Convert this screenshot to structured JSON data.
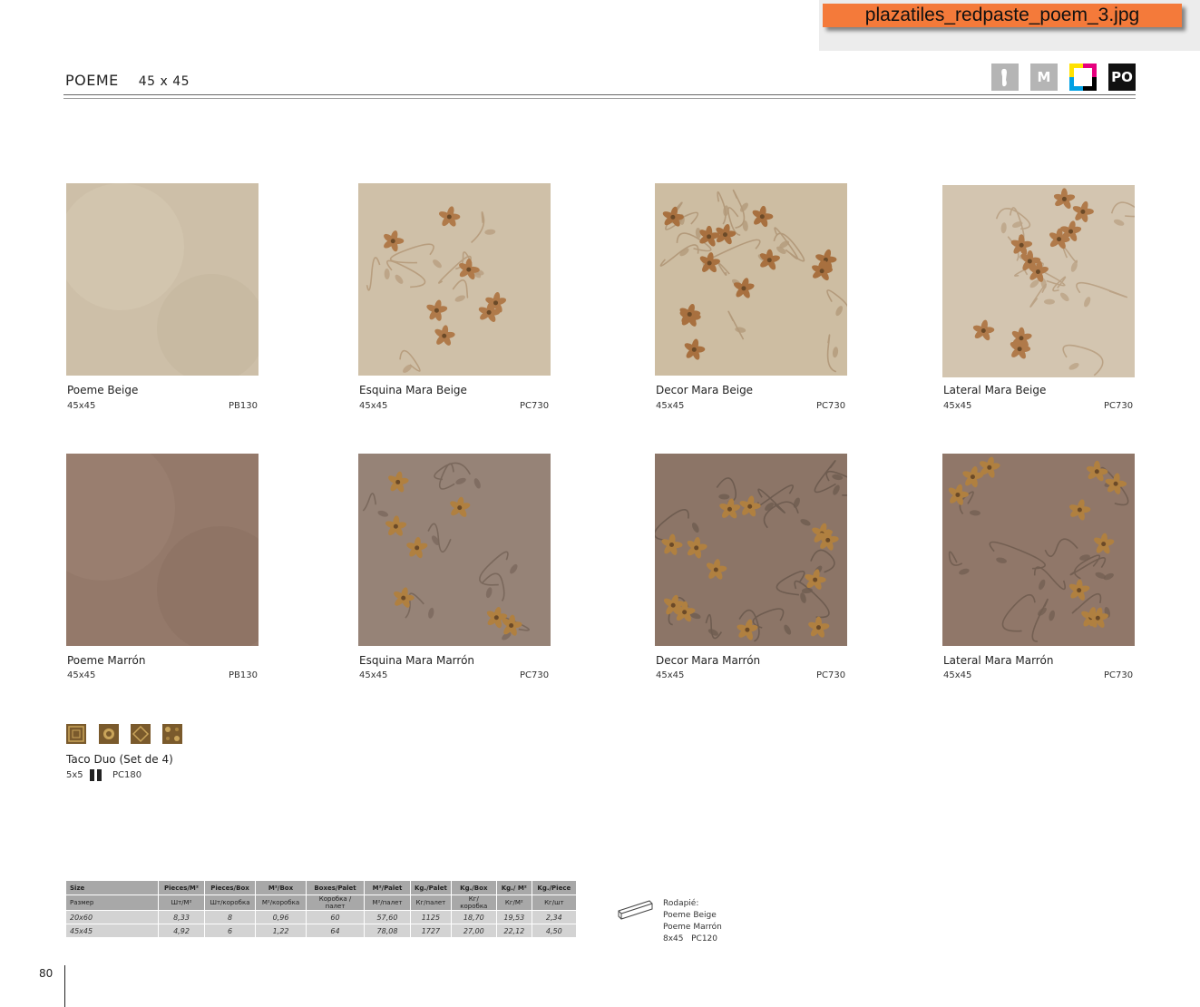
{
  "banner": {
    "filename": "plazatiles_redpaste_poem_3.jpg"
  },
  "header": {
    "series": "POEME",
    "size": "45 x 45"
  },
  "property_icons": [
    {
      "name": "foot-icon",
      "label": ""
    },
    {
      "name": "m-icon",
      "label": "M"
    },
    {
      "name": "color-variation-icon",
      "label": ""
    },
    {
      "name": "po-icon",
      "label": "PO"
    }
  ],
  "products": [
    {
      "name": "Poeme Beige",
      "size": "45x45",
      "code": "PB130",
      "color": "#cdbfa8"
    },
    {
      "name": "Esquina Mara Beige",
      "size": "45x45",
      "code": "PC730",
      "color": "#cfc0a8"
    },
    {
      "name": "Decor Mara Beige",
      "size": "45x45",
      "code": "PC730",
      "color": "#cdbda2"
    },
    {
      "name": "Lateral Mara Beige",
      "size": "45x45",
      "code": "PC730",
      "color": "#d3c5b0"
    },
    {
      "name": "Poeme Marrón",
      "size": "45x45",
      "code": "PB130",
      "color": "#94796a"
    },
    {
      "name": "Esquina Mara Marrón",
      "size": "45x45",
      "code": "PC730",
      "color": "#968377"
    },
    {
      "name": "Decor Mara Marrón",
      "size": "45x45",
      "code": "PC730",
      "color": "#8c7567"
    },
    {
      "name": "Lateral Mara Marrón",
      "size": "45x45",
      "code": "PC730",
      "color": "#907769"
    }
  ],
  "taco": {
    "name": "Taco Duo (Set de 4)",
    "size": "5x5",
    "code": "PC180"
  },
  "spec_table": {
    "headers": [
      "Size",
      "Pieces/M²",
      "Pieces/Box",
      "M²/Box",
      "Boxes/Palet",
      "M²/Palet",
      "Kg./Palet",
      "Kg./Box",
      "Kg./ M²",
      "Kg./Piece"
    ],
    "subheaders": [
      "Размер",
      "Шт/M²",
      "Шт/коробка",
      "M²/коробка",
      "Коробка / палет",
      "M²/палет",
      "Кг/палет",
      "Кг/коробка",
      "Кг/M²",
      "Кг/шт"
    ],
    "rows": [
      [
        "20x60",
        "8,33",
        "8",
        "0,96",
        "60",
        "57,60",
        "1125",
        "18,70",
        "19,53",
        "2,34"
      ],
      [
        "45x45",
        "4,92",
        "6",
        "1,22",
        "64",
        "78,08",
        "1727",
        "27,00",
        "22,12",
        "4,50"
      ]
    ]
  },
  "rodapie": {
    "title": "Rodapié:",
    "item1": "Poeme Beige",
    "item2": "Poeme Marrón",
    "size": "8x45",
    "code": "PC120"
  },
  "page": {
    "number": "80"
  }
}
